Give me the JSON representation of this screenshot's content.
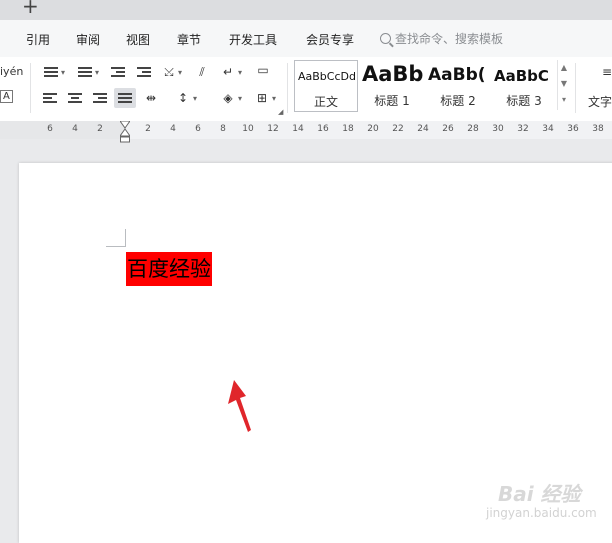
{
  "tabstrip": {
    "new_tab_symbol": "+"
  },
  "menu": {
    "items": [
      "引用",
      "审阅",
      "视图",
      "章节",
      "开发工具",
      "会员专享"
    ],
    "search_placeholder": "查找命令、搜索模板"
  },
  "ribbon": {
    "partial_label_top": "iyén",
    "partial_label_bottom": "A",
    "styles": [
      {
        "sample": "AaBbCcDd",
        "name": "正文"
      },
      {
        "sample": "AaBb",
        "name": "标题 1"
      },
      {
        "sample": "AaBb(",
        "name": "标题 2"
      },
      {
        "sample": "AaBbC",
        "name": "标题 3"
      }
    ],
    "right_partial_label": "文字"
  },
  "ruler": {
    "ticks": [
      "6",
      "4",
      "2",
      "2",
      "4",
      "6",
      "8",
      "10",
      "12",
      "14",
      "16",
      "18",
      "20",
      "22",
      "24",
      "26",
      "28",
      "30",
      "32",
      "34",
      "36",
      "38"
    ]
  },
  "document": {
    "text": "百度经验",
    "highlight_color": "#ff0000",
    "annotation_color": "#e0262b"
  },
  "watermark": {
    "brand": "Bai 经验",
    "url": "jingyan.baidu.com"
  }
}
